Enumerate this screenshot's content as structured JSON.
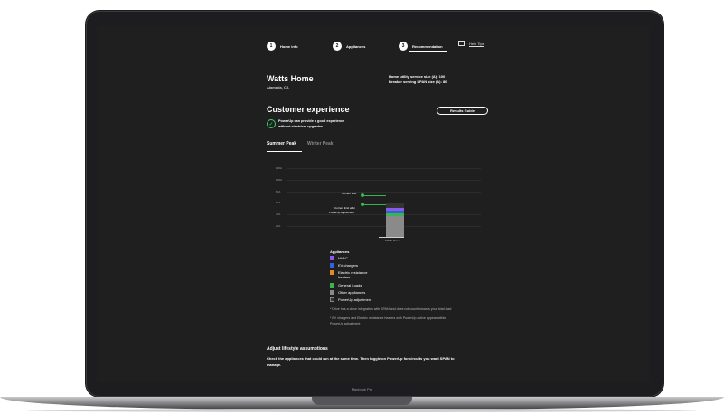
{
  "device": {
    "label": "Macbook Pro"
  },
  "steps": [
    {
      "num": "1",
      "label": "Home info"
    },
    {
      "num": "2",
      "label": "Appliances"
    },
    {
      "num": "3",
      "label": "Recommendation"
    }
  ],
  "help_label": "Help Tips",
  "home": {
    "name": "Watts Home",
    "location": "Alameda, CA",
    "service_size": "Home utility service size (A): 100",
    "span_size": "Breaker serving SPAN size (A): 80"
  },
  "experience": {
    "title": "Customer experience",
    "results_button": "Results Guide",
    "message_line1": "PowerUp can provide a good experience",
    "message_line2": "without electrical upgrades"
  },
  "tabs": {
    "summer": "Summer Peak",
    "winter": "Winter Peak"
  },
  "chart_data": {
    "type": "bar",
    "categories": [
      "SPAN Panel"
    ],
    "yticks": [
      "120A",
      "100A",
      "80A",
      "60A",
      "40A",
      "20A"
    ],
    "ylim": [
      0,
      120
    ],
    "series": [
      {
        "name": "Other appliances",
        "color": "#8a8a8a",
        "values": [
          35
        ]
      },
      {
        "name": "General Loads",
        "color": "#38b54f",
        "values": [
          5
        ]
      },
      {
        "name": "EV chargers",
        "color": "#2f63e0",
        "values": [
          5
        ]
      },
      {
        "name": "HVAC",
        "color": "#8a5be6",
        "values": [
          4
        ]
      },
      {
        "name": "PowerUp adjustment",
        "color": "#333333",
        "values": [
          9
        ]
      }
    ],
    "annotations": {
      "current_limit": "Current limit",
      "limit_after_line1": "Current limit after",
      "limit_after_line2": "PowerUp adjustment"
    }
  },
  "legend": {
    "title": "Appliances",
    "items": [
      {
        "label": "HVAC",
        "color": "#8a5be6"
      },
      {
        "label": "EV chargers",
        "color": "#2f63e0"
      },
      {
        "label": "Electric resistance",
        "label2": "heaters",
        "color": "#e8862a"
      },
      {
        "label": "General Loads",
        "color": "#38b54f"
      },
      {
        "label": "Other appliances",
        "color": "#8a8a8a"
      },
      {
        "label": "PowerUp adjustment",
        "color": "#333333"
      }
    ]
  },
  "notes": {
    "drive": "* Drive has a close integration with SPAN and does not count towards your total load",
    "ev_line1": "* EV chargers and Electric resistance heaters with PowerUp active appear within",
    "ev_line2": "PowerUp adjustment"
  },
  "lifestyle": {
    "title": "Adjust lifestyle assumptions",
    "desc_line1": "Check the appliances that could run at the same time. Then toggle on PowerUp for circuits you want SPAN to",
    "desc_line2": "manage."
  }
}
